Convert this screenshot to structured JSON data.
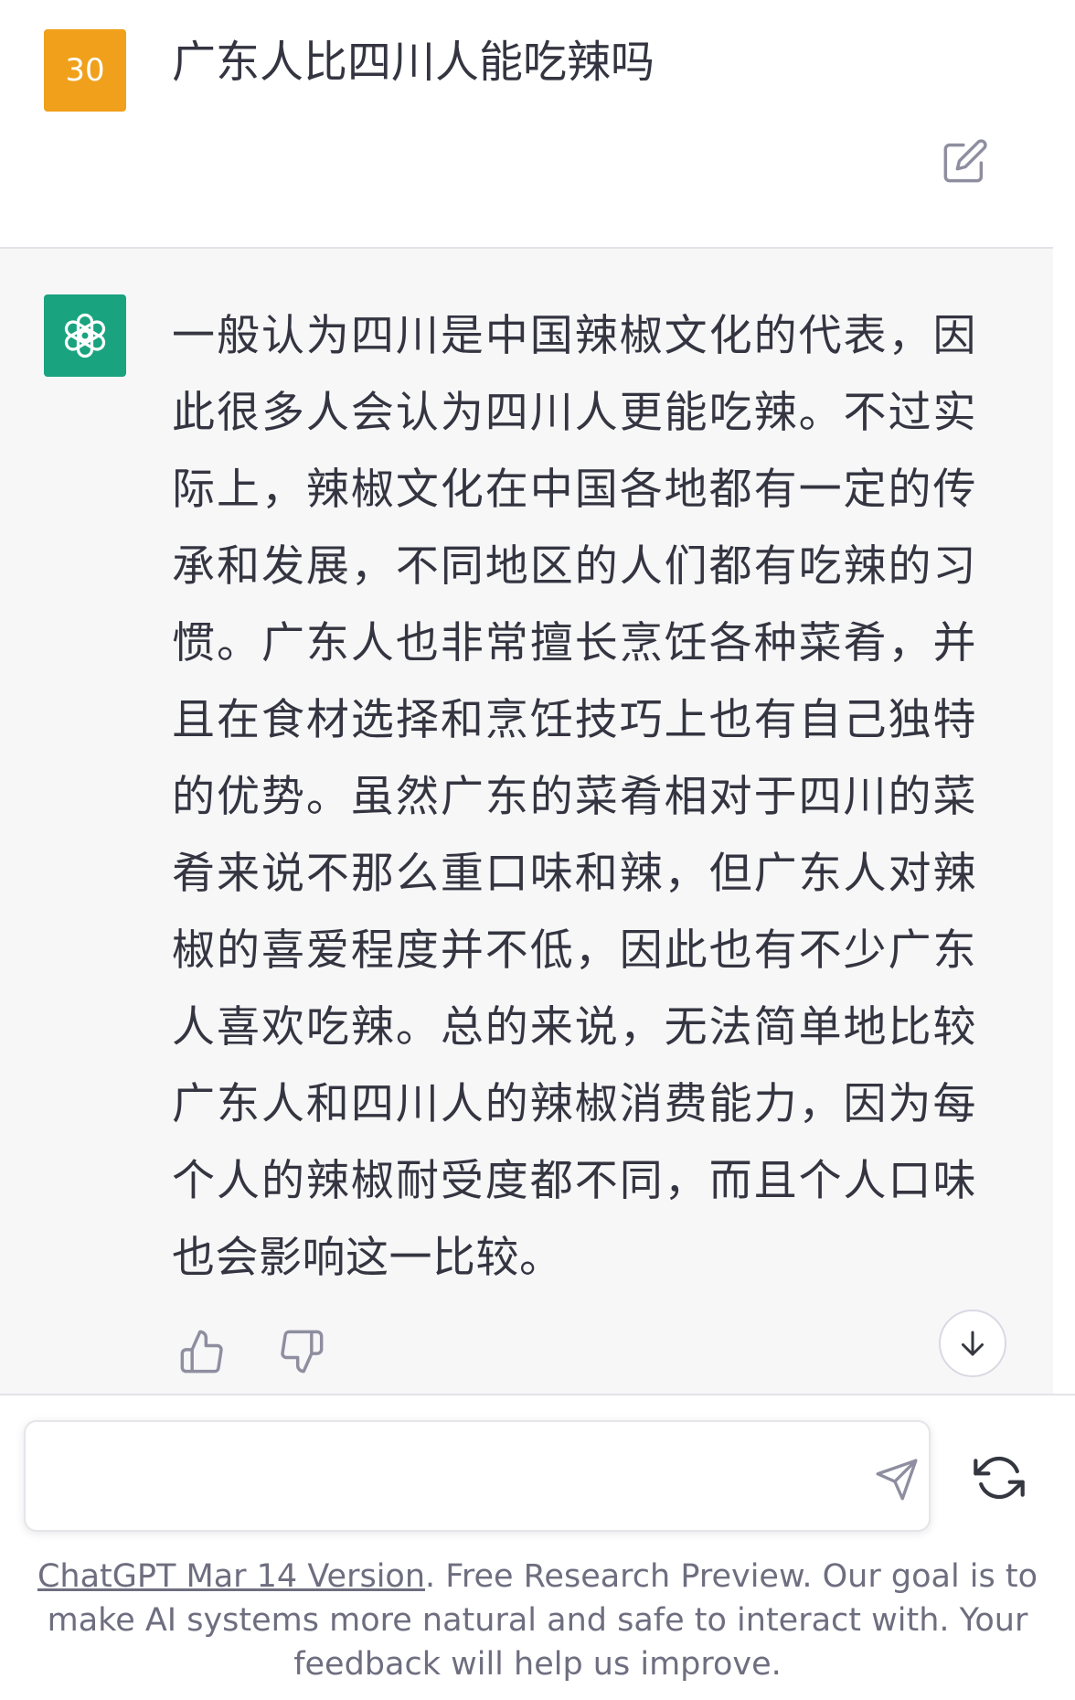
{
  "user_message": {
    "avatar_text": "30",
    "avatar_color": "#f0a01a",
    "text": "广东人比四川人能吃辣吗"
  },
  "assistant_message": {
    "avatar_color": "#19a37f",
    "avatar_icon": "openai-logo-icon",
    "text": "一般认为四川是中国辣椒文化的代表，因此很多人会认为四川人更能吃辣。不过实际上，辣椒文化在中国各地都有一定的传承和发展，不同地区的人们都有吃辣的习惯。广东人也非常擅长烹饪各种菜肴，并且在食材选择和烹饪技巧上也有自己独特的优势。虽然广东的菜肴相对于四川的菜肴来说不那么重口味和辣，但广东人对辣椒的喜爱程度并不低，因此也有不少广东人喜欢吃辣。总的来说，无法简单地比较广东人和四川人的辣椒消费能力，因为每个人的辣椒耐受度都不同，而且个人口味也会影响这一比较。"
  },
  "composer": {
    "placeholder": ""
  },
  "footer": {
    "link_text": "ChatGPT Mar 14 Version",
    "text": ". Free Research Preview. Our goal is to make AI systems more natural and safe to interact with. Your feedback will help us improve."
  }
}
